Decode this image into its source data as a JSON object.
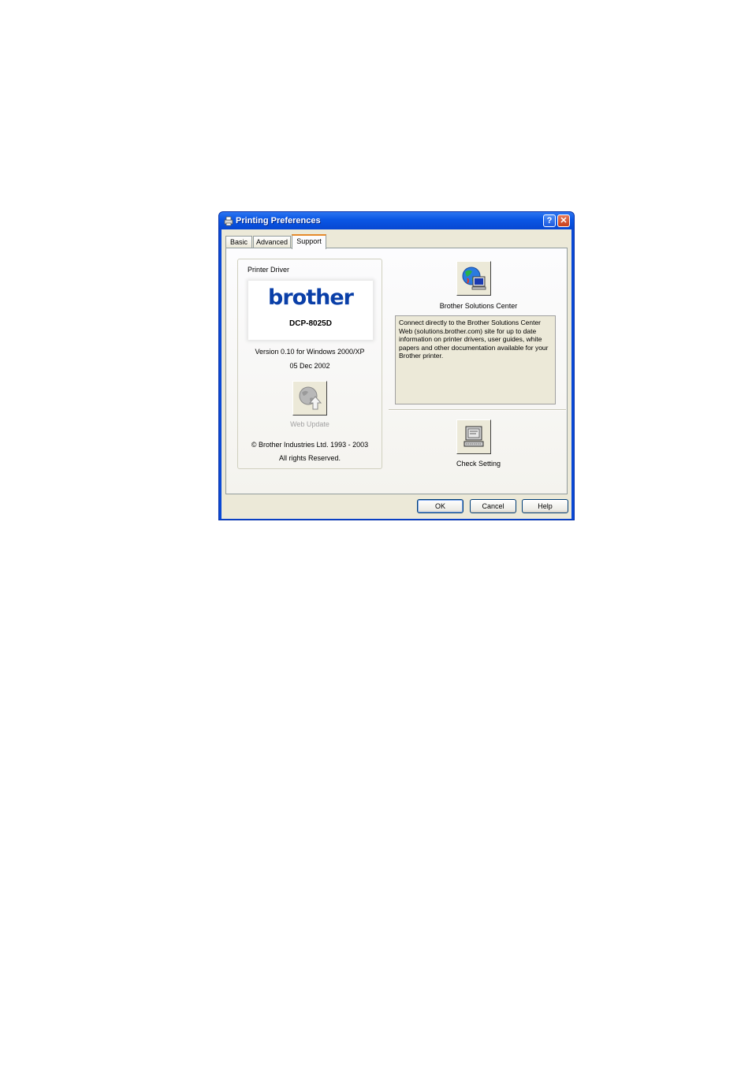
{
  "window": {
    "title": "Printing Preferences"
  },
  "tabs": [
    {
      "label": "Basic"
    },
    {
      "label": "Advanced"
    },
    {
      "label": "Support"
    }
  ],
  "driver_group": {
    "label": "Printer Driver",
    "logo_text": "brother",
    "model": "DCP-8025D",
    "version": "Version 0.10 for Windows 2000/XP",
    "date": "05 Dec 2002",
    "web_update_label": "Web Update",
    "copyright": "© Brother Industries Ltd. 1993 - 2003",
    "rights": "All rights Reserved."
  },
  "solutions": {
    "label": "Brother Solutions Center",
    "description": "Connect directly to the Brother Solutions Center Web (solutions.brother.com) site for up to date information on printer drivers, user guides, white papers and other documentation available for your Brother printer."
  },
  "check_setting": {
    "label": "Check Setting"
  },
  "buttons": {
    "ok": "OK",
    "cancel": "Cancel",
    "help": "Help"
  },
  "title_buttons": {
    "help": "?",
    "close": "✕"
  },
  "colors": {
    "titlebar": "#0a56e4",
    "face": "#ece9d8",
    "brand_blue": "#0a3fa8",
    "tab_highlight": "#e68b2c"
  }
}
